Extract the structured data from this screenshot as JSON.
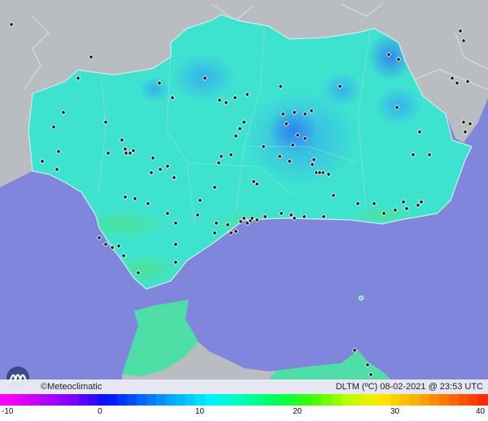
{
  "map": {
    "source_credit": "©Meteoclimatic",
    "title": "DLTM (ºC) 08-02-2021 @ 23:53 UTC",
    "logo_name": "meteoclimatic-logo",
    "colors": {
      "sea": "#7f86dc",
      "land_outside": "#b9bcc0",
      "andalusia_base": "#3ee3d0",
      "andalusia_cool": "#37c6e7",
      "coast_warm": "#4ddfa6",
      "station_marker": "#1c1c1c"
    },
    "legend": {
      "min_value": -10,
      "max_value": 40,
      "tick_labels": [
        "-10",
        "0",
        "10",
        "20",
        "30",
        "40"
      ],
      "gradient_stops": [
        "#ff00ff",
        "#c000ff",
        "#7a00ff",
        "#0010ff",
        "#0066ff",
        "#00b2ff",
        "#00f2ff",
        "#00ffae",
        "#00ff50",
        "#3eff00",
        "#b8ff00",
        "#ffea00",
        "#ffb000",
        "#ff7000",
        "#ff2a00"
      ]
    }
  }
}
